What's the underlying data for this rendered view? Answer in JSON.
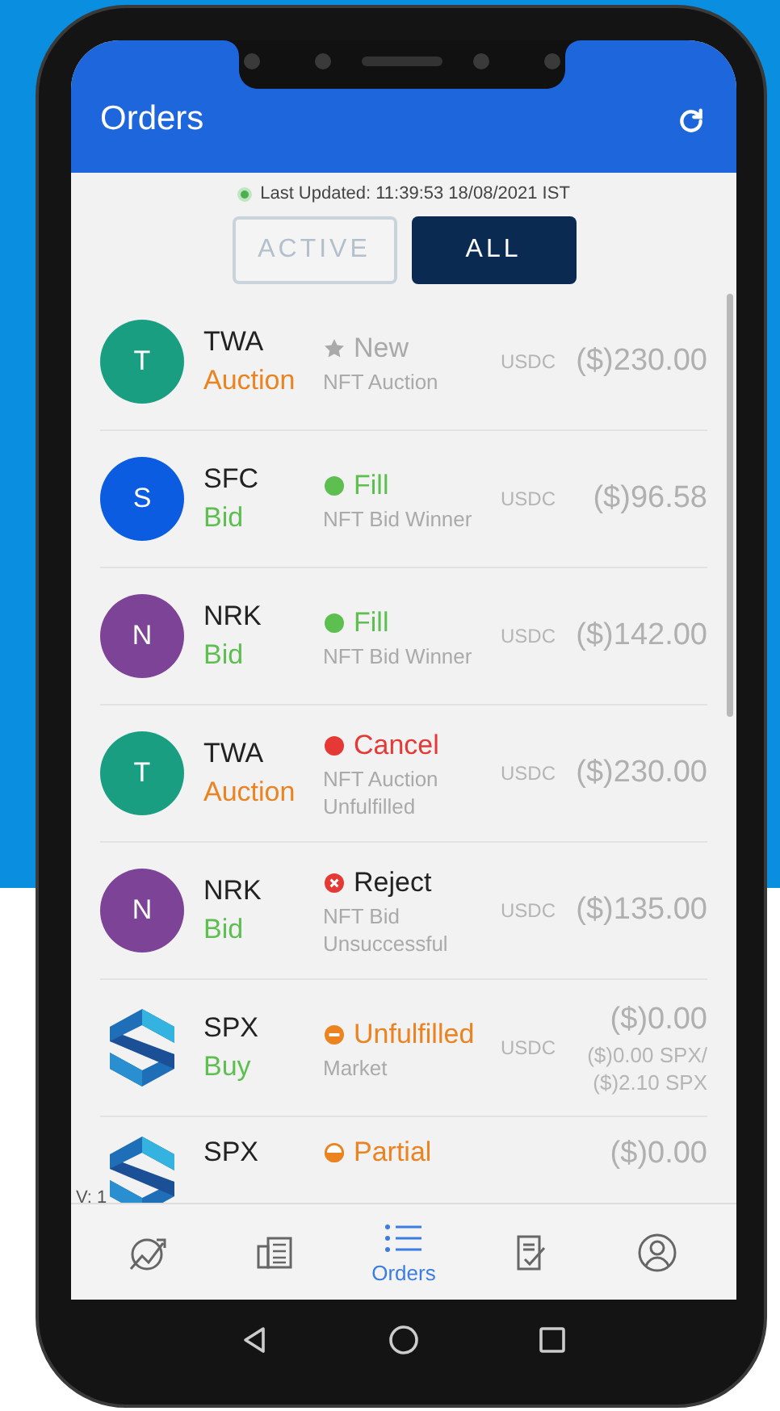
{
  "header": {
    "title": "Orders"
  },
  "last_updated": {
    "text": "Last Updated: 11:39:53 18/08/2021 IST",
    "color": "#4caf50"
  },
  "tabs": [
    {
      "label": "ACTIVE",
      "selected": false
    },
    {
      "label": "ALL",
      "selected": true
    }
  ],
  "orders": [
    {
      "avatar": {
        "kind": "letter",
        "letter": "T",
        "color": "#1a9e82"
      },
      "symbol": "TWA",
      "type": {
        "text": "Auction",
        "kind": "auction"
      },
      "status": {
        "text": "New",
        "kind": "new"
      },
      "description": [
        "NFT Auction"
      ],
      "currency": "USDC",
      "amount": "($)230.00"
    },
    {
      "avatar": {
        "kind": "letter",
        "letter": "S",
        "color": "#0b5ce0"
      },
      "symbol": "SFC",
      "type": {
        "text": "Bid",
        "kind": "bid"
      },
      "status": {
        "text": "Fill",
        "kind": "fill"
      },
      "description": [
        "NFT Bid Winner"
      ],
      "currency": "USDC",
      "amount": "($)96.58"
    },
    {
      "avatar": {
        "kind": "letter",
        "letter": "N",
        "color": "#7d4397"
      },
      "symbol": "NRK",
      "type": {
        "text": "Bid",
        "kind": "bid"
      },
      "status": {
        "text": "Fill",
        "kind": "fill"
      },
      "description": [
        "NFT Bid Winner"
      ],
      "currency": "USDC",
      "amount": "($)142.00"
    },
    {
      "avatar": {
        "kind": "letter",
        "letter": "T",
        "color": "#1a9e82"
      },
      "symbol": "TWA",
      "type": {
        "text": "Auction",
        "kind": "auction"
      },
      "status": {
        "text": "Cancel",
        "kind": "cancel"
      },
      "description": [
        "NFT Auction",
        "Unfulfilled"
      ],
      "currency": "USDC",
      "amount": "($)230.00"
    },
    {
      "avatar": {
        "kind": "letter",
        "letter": "N",
        "color": "#7d4397"
      },
      "symbol": "NRK",
      "type": {
        "text": "Bid",
        "kind": "bid"
      },
      "status": {
        "text": "Reject",
        "kind": "reject"
      },
      "description": [
        "NFT Bid",
        "Unsuccessful"
      ],
      "currency": "USDC",
      "amount": "($)135.00"
    },
    {
      "avatar": {
        "kind": "logo"
      },
      "symbol": "SPX",
      "type": {
        "text": "Buy",
        "kind": "buy"
      },
      "status": {
        "text": "Unfulfilled",
        "kind": "unfulfilled"
      },
      "description": [
        "Market"
      ],
      "currency": "USDC",
      "amount": "($)0.00",
      "detail": [
        "($)0.00 SPX/",
        "($)2.10 SPX"
      ]
    },
    {
      "avatar": {
        "kind": "logo"
      },
      "symbol": "SPX",
      "status": {
        "text": "Partial",
        "kind": "partial"
      },
      "amount": "($)0.00"
    }
  ],
  "version": "V: 1",
  "bottom_nav": [
    {
      "kind": "chart",
      "selected": false
    },
    {
      "kind": "news",
      "selected": false
    },
    {
      "kind": "orders",
      "label": "Orders",
      "selected": true
    },
    {
      "kind": "document",
      "selected": false
    },
    {
      "kind": "profile",
      "selected": false
    }
  ],
  "system_nav": [
    {
      "kind": "back"
    },
    {
      "kind": "home"
    },
    {
      "kind": "recents"
    }
  ]
}
